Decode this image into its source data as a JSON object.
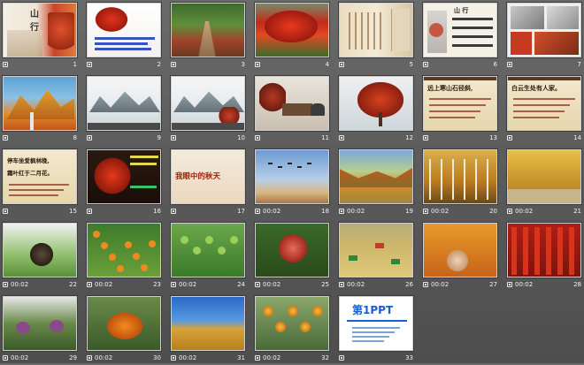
{
  "slides": [
    {
      "number": "1",
      "timing": "",
      "theme": "title",
      "text": [
        "山",
        "行"
      ]
    },
    {
      "number": "2",
      "timing": "",
      "theme": "leaf-text",
      "text": []
    },
    {
      "number": "3",
      "timing": "",
      "theme": "path",
      "text": []
    },
    {
      "number": "4",
      "timing": "",
      "theme": "maple",
      "text": []
    },
    {
      "number": "5",
      "timing": "",
      "theme": "scroll",
      "text": []
    },
    {
      "number": "6",
      "timing": "",
      "theme": "poem",
      "text": [
        "山 行"
      ]
    },
    {
      "number": "7",
      "timing": "",
      "theme": "collage",
      "text": []
    },
    {
      "number": "8",
      "timing": "",
      "theme": "mountains",
      "text": []
    },
    {
      "number": "9",
      "timing": "",
      "theme": "ink",
      "text": []
    },
    {
      "number": "10",
      "timing": "",
      "theme": "ink2",
      "text": []
    },
    {
      "number": "11",
      "timing": "",
      "theme": "cart",
      "text": []
    },
    {
      "number": "12",
      "timing": "",
      "theme": "tree",
      "text": []
    },
    {
      "number": "13",
      "timing": "",
      "theme": "verse",
      "text": [
        "远上寒山石径斜,"
      ]
    },
    {
      "number": "14",
      "timing": "",
      "theme": "verse",
      "text": [
        "白云生处有人家。"
      ]
    },
    {
      "number": "15",
      "timing": "",
      "theme": "verse2",
      "text": [
        "停车坐爱枫林晚,",
        "霜叶红于二月花。"
      ]
    },
    {
      "number": "16",
      "timing": "",
      "theme": "redleaf",
      "text": []
    },
    {
      "number": "17",
      "timing": "",
      "theme": "autumn-title",
      "text": [
        "我眼中的秋天"
      ]
    },
    {
      "number": "18",
      "timing": "00:02",
      "theme": "sky",
      "text": []
    },
    {
      "number": "19",
      "timing": "00:02",
      "theme": "valley",
      "text": []
    },
    {
      "number": "20",
      "timing": "00:02",
      "theme": "forest",
      "text": []
    },
    {
      "number": "21",
      "timing": "00:02",
      "theme": "trees",
      "text": []
    },
    {
      "number": "22",
      "timing": "00:02",
      "theme": "squirrel",
      "text": []
    },
    {
      "number": "23",
      "timing": "00:02",
      "theme": "orange",
      "text": []
    },
    {
      "number": "24",
      "timing": "00:02",
      "theme": "green",
      "text": []
    },
    {
      "number": "25",
      "timing": "00:02",
      "theme": "pomegranate",
      "text": []
    },
    {
      "number": "26",
      "timing": "00:02",
      "theme": "field",
      "text": []
    },
    {
      "number": "27",
      "timing": "00:02",
      "theme": "corn",
      "text": []
    },
    {
      "number": "28",
      "timing": "00:02",
      "theme": "chili",
      "text": []
    },
    {
      "number": "29",
      "timing": "00:02",
      "theme": "cabbage",
      "text": []
    },
    {
      "number": "30",
      "timing": "00:02",
      "theme": "pumpkin",
      "text": []
    },
    {
      "number": "31",
      "timing": "00:02",
      "theme": "wheat",
      "text": []
    },
    {
      "number": "32",
      "timing": "00:02",
      "theme": "flowers",
      "text": []
    },
    {
      "number": "33",
      "timing": "",
      "theme": "logo",
      "text": [
        "第1PPT"
      ]
    }
  ],
  "colors": {
    "background": "#5e5e5e",
    "label": "#f2f2f2",
    "border": "#cfcfcf"
  }
}
